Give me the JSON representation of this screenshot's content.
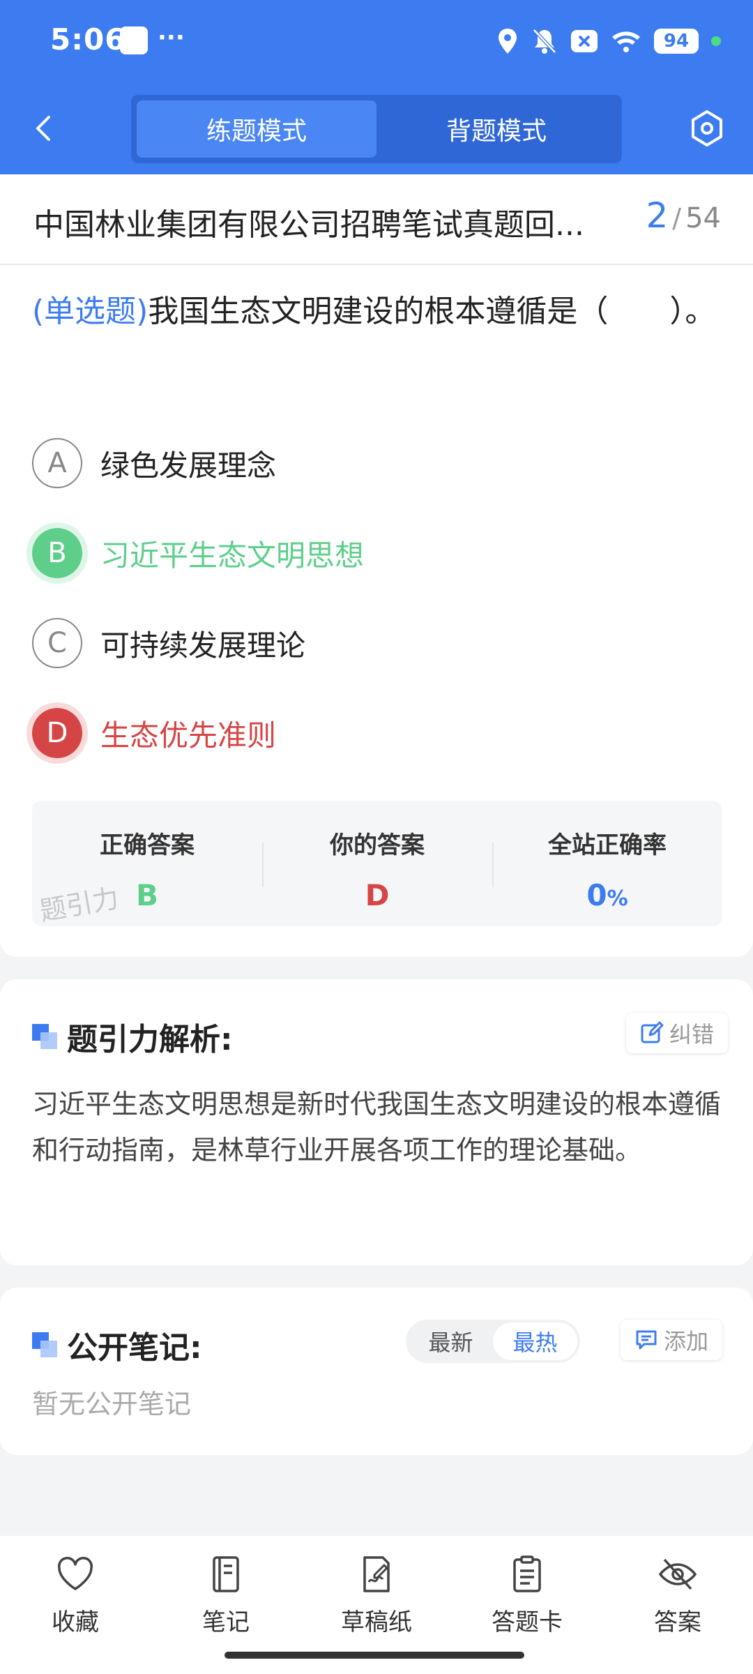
{
  "status_bar": {
    "time": "5:06",
    "dots": "···",
    "battery": "94"
  },
  "header": {
    "tabs": [
      {
        "label": "练题模式",
        "active": true
      },
      {
        "label": "背题模式",
        "active": false
      }
    ]
  },
  "paper": {
    "title": "中国林业集团有限公司招聘笔试真题回...",
    "current": "2",
    "separator": "/",
    "total": "54"
  },
  "question": {
    "type": "(单选题)",
    "text": "我国生态文明建设的根本遵循是（　　）。",
    "options": [
      {
        "letter": "A",
        "text": "绿色发展理念",
        "state": "normal"
      },
      {
        "letter": "B",
        "text": "习近平生态文明思想",
        "state": "correct"
      },
      {
        "letter": "C",
        "text": "可持续发展理论",
        "state": "normal"
      },
      {
        "letter": "D",
        "text": "生态优先准则",
        "state": "wrong"
      }
    ]
  },
  "answers": {
    "correct_label": "正确答案",
    "correct_value": "B",
    "yours_label": "你的答案",
    "yours_value": "D",
    "rate_label": "全站正确率",
    "rate_value": "0",
    "rate_unit": "%",
    "watermark": "题引力"
  },
  "analysis": {
    "title": "题引力解析:",
    "report_label": "纠错",
    "text": "习近平生态文明思想是新时代我国生态文明建设的根本遵循和行动指南，是林草行业开展各项工作的理论基础。"
  },
  "notes": {
    "title": "公开笔记:",
    "sort_latest": "最新",
    "sort_hot": "最热",
    "add_label": "添加",
    "empty": "暂无公开笔记"
  },
  "bottom_nav": [
    {
      "label": "收藏",
      "icon": "heart-icon"
    },
    {
      "label": "笔记",
      "icon": "notebook-icon"
    },
    {
      "label": "草稿纸",
      "icon": "draft-icon"
    },
    {
      "label": "答题卡",
      "icon": "answer-card-icon"
    },
    {
      "label": "答案",
      "icon": "eye-off-icon"
    }
  ],
  "colors": {
    "primary": "#3d7cf0",
    "correct": "#5ecf8b",
    "wrong": "#d64545"
  }
}
